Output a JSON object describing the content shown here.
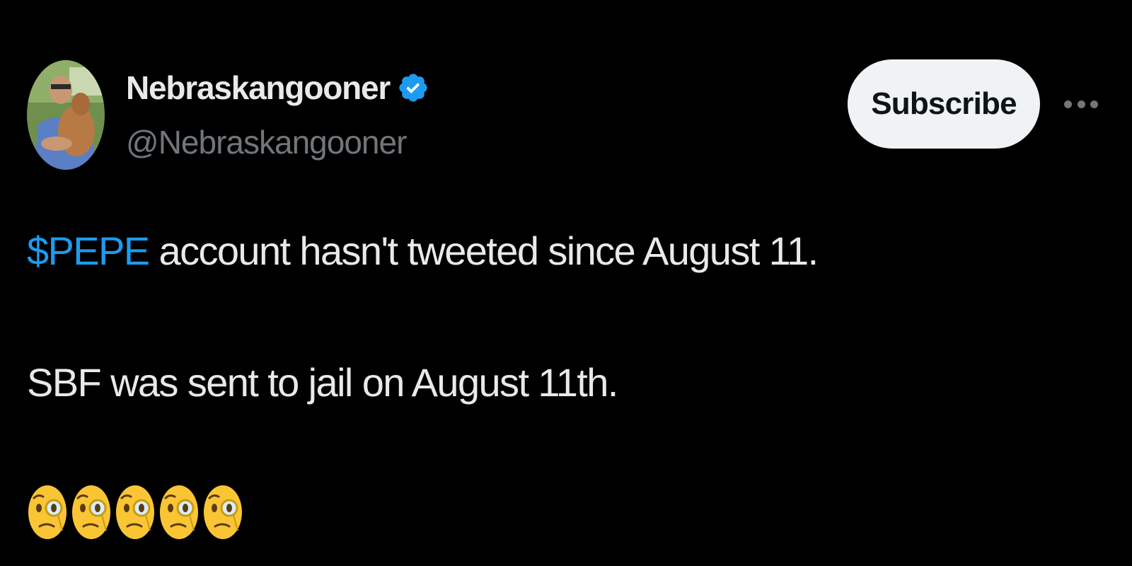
{
  "author": {
    "display_name": "Nebraskangooner",
    "handle": "@Nebraskangooner",
    "verified": true
  },
  "actions": {
    "subscribe_label": "Subscribe",
    "more_icon": "more-horizontal-icon"
  },
  "tweet": {
    "line1": {
      "cashtag": "$PEPE",
      "text": " account hasn't tweeted since August 11."
    },
    "line2": "SBF was sent to jail on August 11th.",
    "emoji": {
      "name": "face-with-monocle",
      "count": 5
    }
  },
  "colors": {
    "background": "#000000",
    "text": "#e7e9ea",
    "secondary": "#71767b",
    "accent": "#1d9bf0",
    "button_bg": "#eff3f4"
  }
}
